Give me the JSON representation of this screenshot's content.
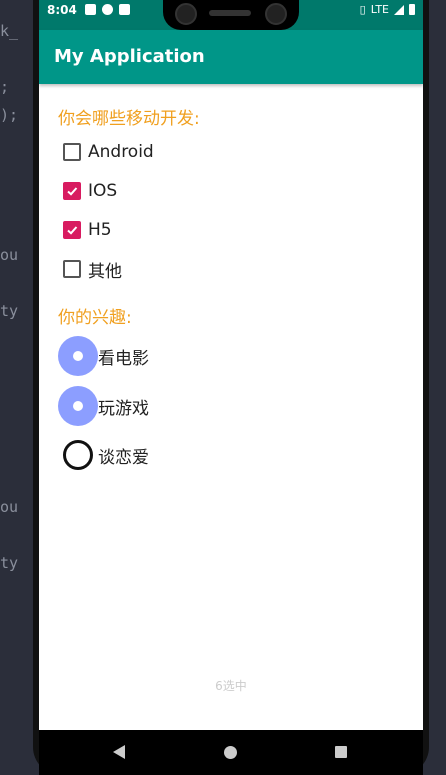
{
  "ide": {
    "fragments": [
      "k_",
      ";",
      ");",
      "ou",
      "ty",
      "ou",
      "ty"
    ]
  },
  "status_bar": {
    "time": "8:04",
    "network": "LTE"
  },
  "app_bar": {
    "title": "My Application"
  },
  "mobile_section": {
    "title": "你会哪些移动开发:",
    "options": [
      {
        "label": "Android",
        "checked": false
      },
      {
        "label": "IOS",
        "checked": true
      },
      {
        "label": "H5",
        "checked": true
      },
      {
        "label": "其他",
        "checked": false
      }
    ]
  },
  "hobby_section": {
    "title": "你的兴趣:",
    "options": [
      {
        "label": "看电影",
        "selected": true
      },
      {
        "label": "玩游戏",
        "selected": true
      },
      {
        "label": "谈恋爱",
        "selected": false
      }
    ]
  },
  "footer": {
    "text": "6选中"
  },
  "colors": {
    "primary": "#009688",
    "status": "#00796b",
    "accent": "#d81b60",
    "section_title": "#f0a020",
    "radio_selected": "#8c9eff"
  }
}
